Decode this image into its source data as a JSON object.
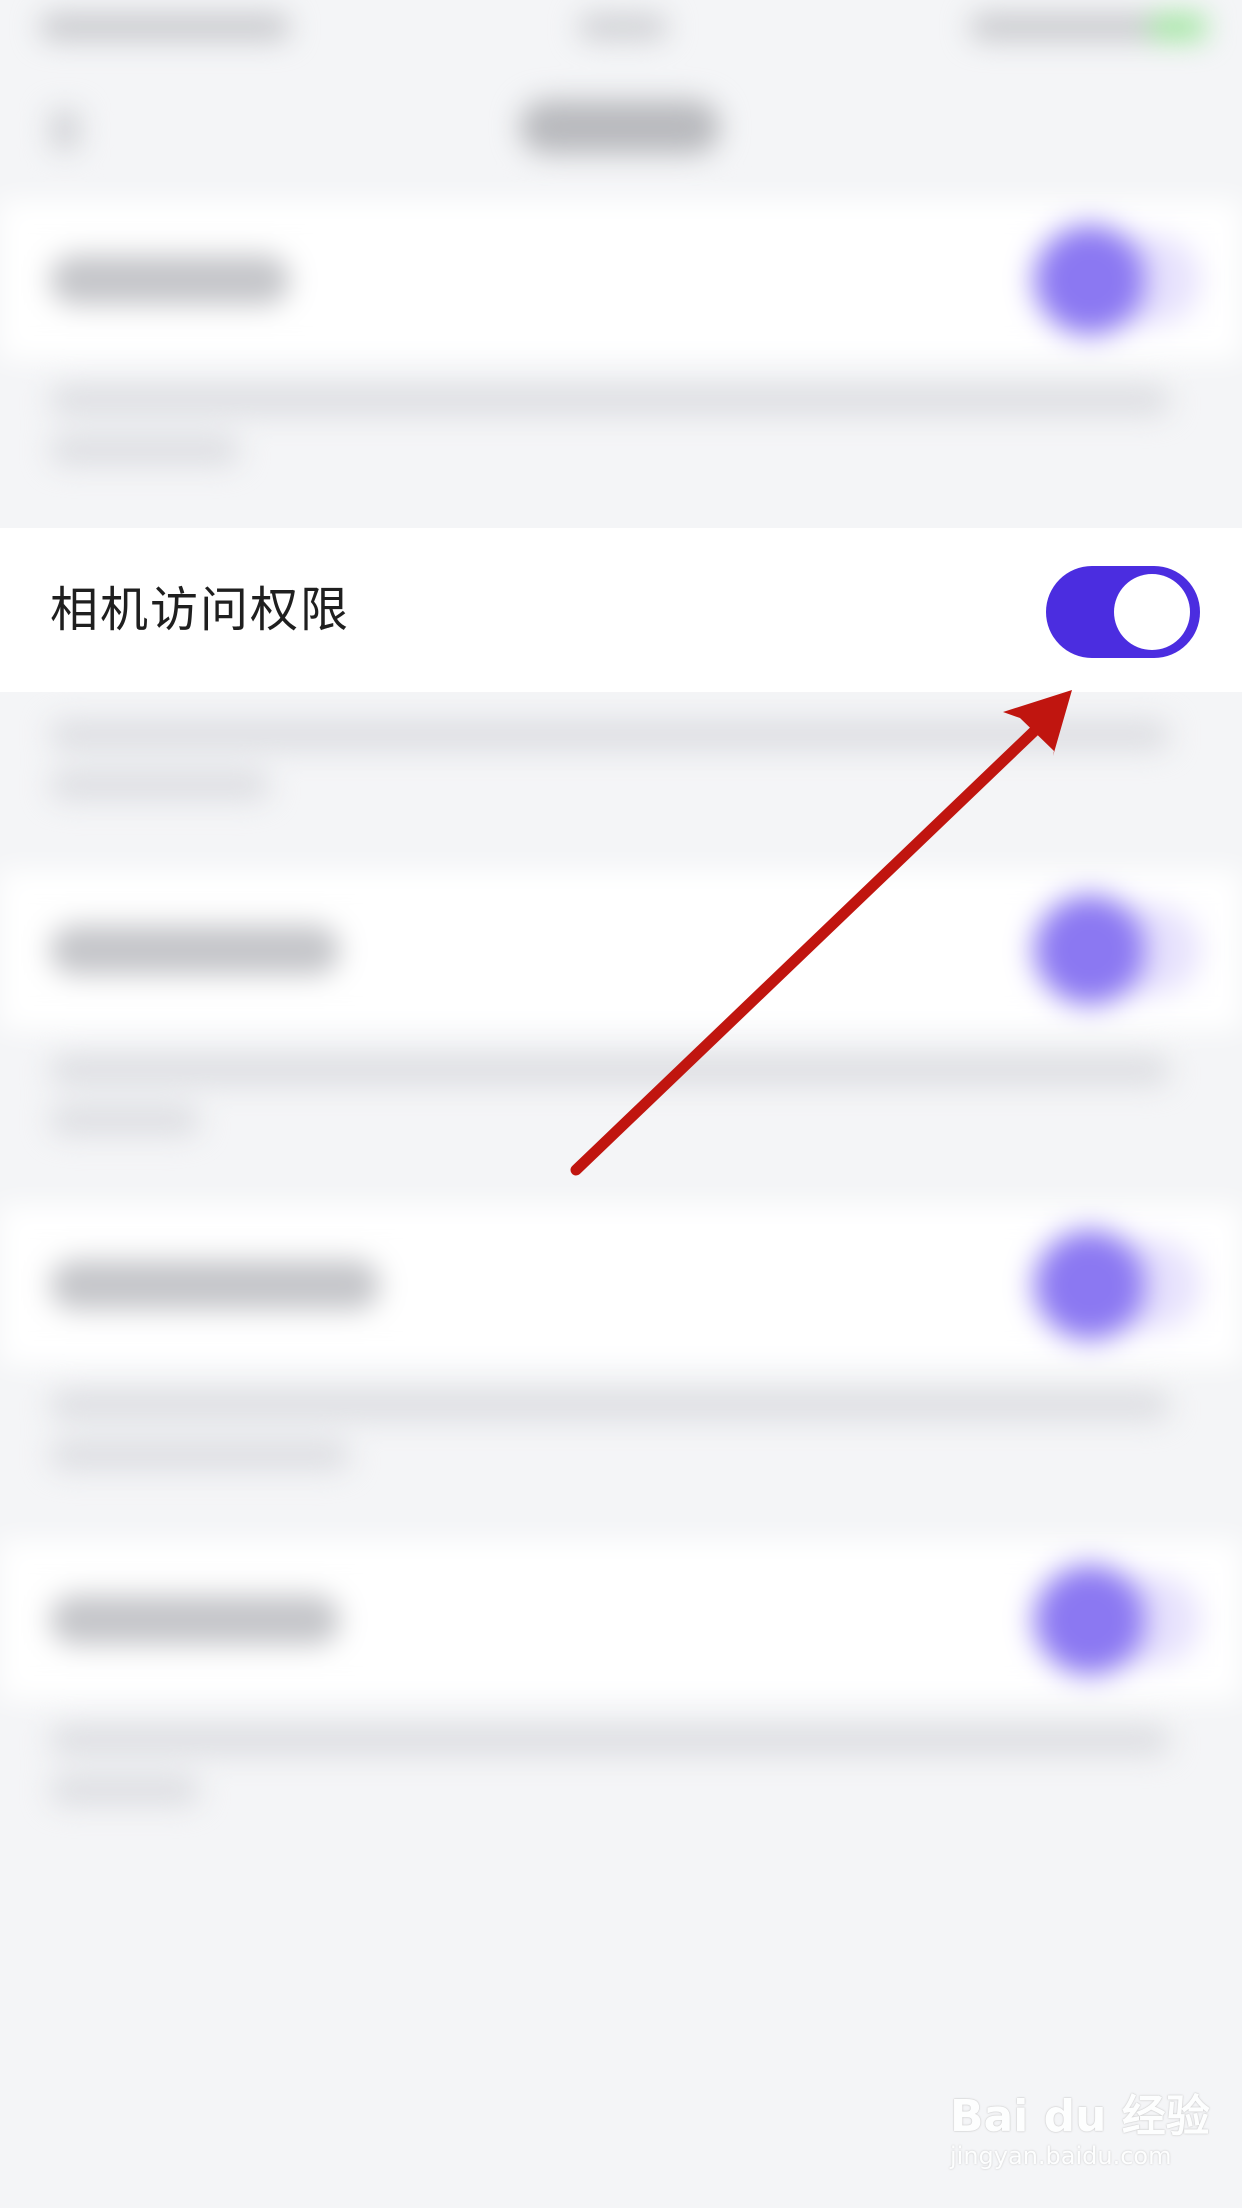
{
  "highlight_row": {
    "label": "相机访问权限",
    "toggle_on": true
  },
  "colors": {
    "toggle_track": "#4b2de0",
    "toggle_knob": "#ffffff",
    "arrow": "#c0150f",
    "background": "#f4f5f7",
    "row_background": "#ffffff"
  },
  "watermark": {
    "brand": "Bai du 经验",
    "url": "jingyan.baidu.com"
  }
}
